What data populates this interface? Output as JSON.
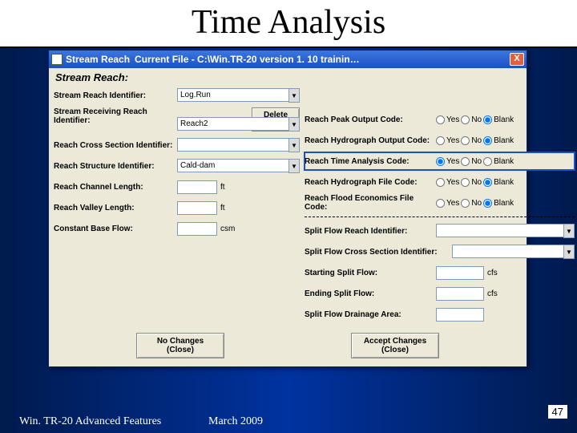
{
  "slide": {
    "title": "Time Analysis",
    "footer_left": "Win. TR-20 Advanced Features",
    "footer_mid": "March 2009",
    "page_number": "47"
  },
  "window": {
    "app_name": "Stream Reach",
    "file_label": "Current File  -  C:\\Win.TR-20 version 1. 10 trainin…",
    "close": "X",
    "section_title": "Stream Reach:",
    "delete_btn": "Delete\nReach",
    "no_changes_btn": "No Changes\n(Close)",
    "accept_btn": "Accept Changes\n(Close)"
  },
  "left": {
    "reach_id_label": "Stream Reach Identifier:",
    "reach_id_value": "Log.Run",
    "receiving_label": "Stream Receiving  Reach Identifier:",
    "receiving_value": "Reach2",
    "cross_label": "Reach Cross Section Identifier:",
    "cross_value": "",
    "struct_label": "Reach Structure Identifier:",
    "struct_value": "Cald-dam",
    "chan_len_label": "Reach Channel Length:",
    "chan_len_value": "",
    "chan_len_unit": "ft",
    "valley_len_label": "Reach Valley Length:",
    "valley_len_value": "",
    "valley_len_unit": "ft",
    "base_flow_label": "Constant Base Flow:",
    "base_flow_value": "",
    "base_flow_unit": "csm"
  },
  "right": {
    "peak_label": "Reach Peak Output Code:",
    "hydro_out_label": "Reach Hydrograph Output Code:",
    "time_label": "Reach Time Analysis Code:",
    "hydro_file_label": "Reach Hydrograph File Code:",
    "flood_econ_label": "Reach Flood Economics File Code:",
    "split_reach_label": "Split Flow Reach Identifier:",
    "split_reach_value": "",
    "split_cross_label": "Split Flow Cross Section Identifier:",
    "split_cross_value": "",
    "start_split_label": "Starting Split Flow:",
    "start_split_value": "",
    "start_split_unit": "cfs",
    "end_split_label": "Ending Split Flow:",
    "end_split_value": "",
    "end_split_unit": "cfs",
    "drain_area_label": "Split Flow Drainage Area:",
    "drain_area_value": ""
  },
  "radio": {
    "yes": "Yes",
    "no": "No",
    "blank": "Blank"
  }
}
